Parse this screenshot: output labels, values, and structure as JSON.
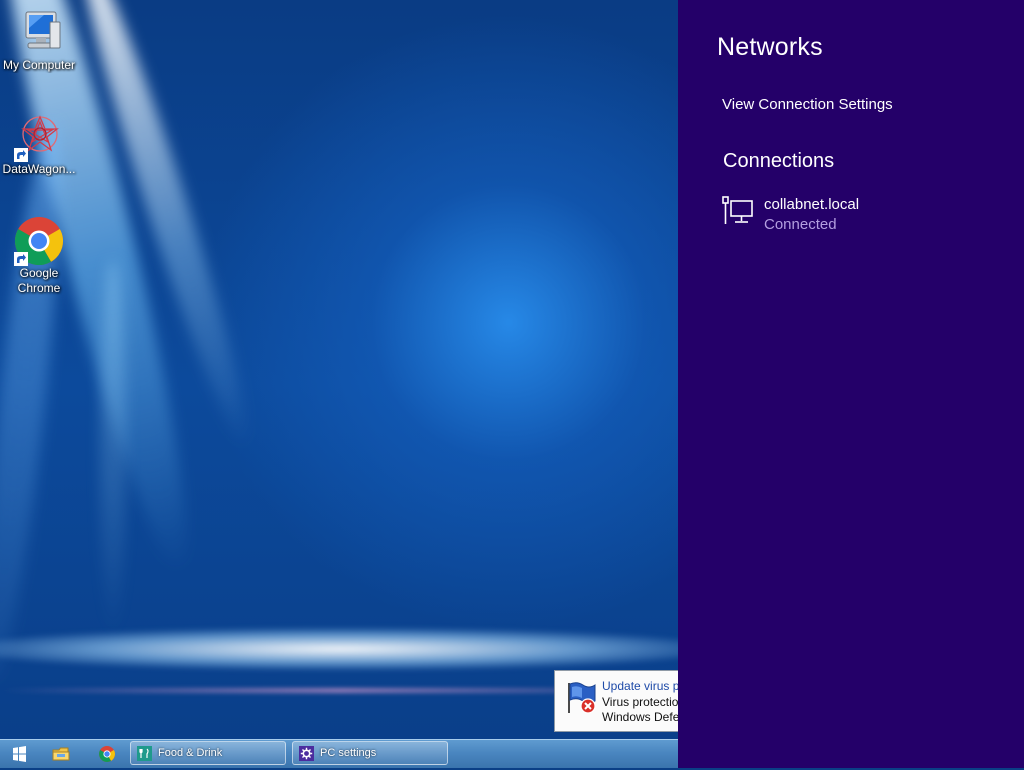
{
  "desktop": {
    "icons": [
      {
        "label": "My Computer",
        "icon": "computer-icon"
      },
      {
        "label": "DataWagon...",
        "icon": "datawagon-icon"
      },
      {
        "label": "Google Chrome",
        "icon": "chrome-icon"
      }
    ]
  },
  "network_panel": {
    "title": "Networks",
    "view_settings_link": "View Connection Settings",
    "connections_heading": "Connections",
    "connection": {
      "name": "collabnet.local",
      "status": "Connected",
      "icon": "wired-network-icon"
    }
  },
  "notification": {
    "title": "Update virus p",
    "line1": "Virus protectio",
    "line2": "Windows Defe",
    "icon": "windows-defender-flag-icon"
  },
  "taskbar": {
    "start_icon": "windows-logo-icon",
    "pinned": [
      {
        "icon": "file-explorer-icon"
      },
      {
        "icon": "chrome-icon"
      }
    ],
    "tasks": [
      {
        "label": "Food & Drink",
        "icon": "food-drink-icon"
      },
      {
        "label": "PC settings",
        "icon": "gear-icon"
      }
    ]
  },
  "colors": {
    "panel_bg": "#240069",
    "status_text": "#b39ee0",
    "taskbar": "#4a86c0"
  }
}
